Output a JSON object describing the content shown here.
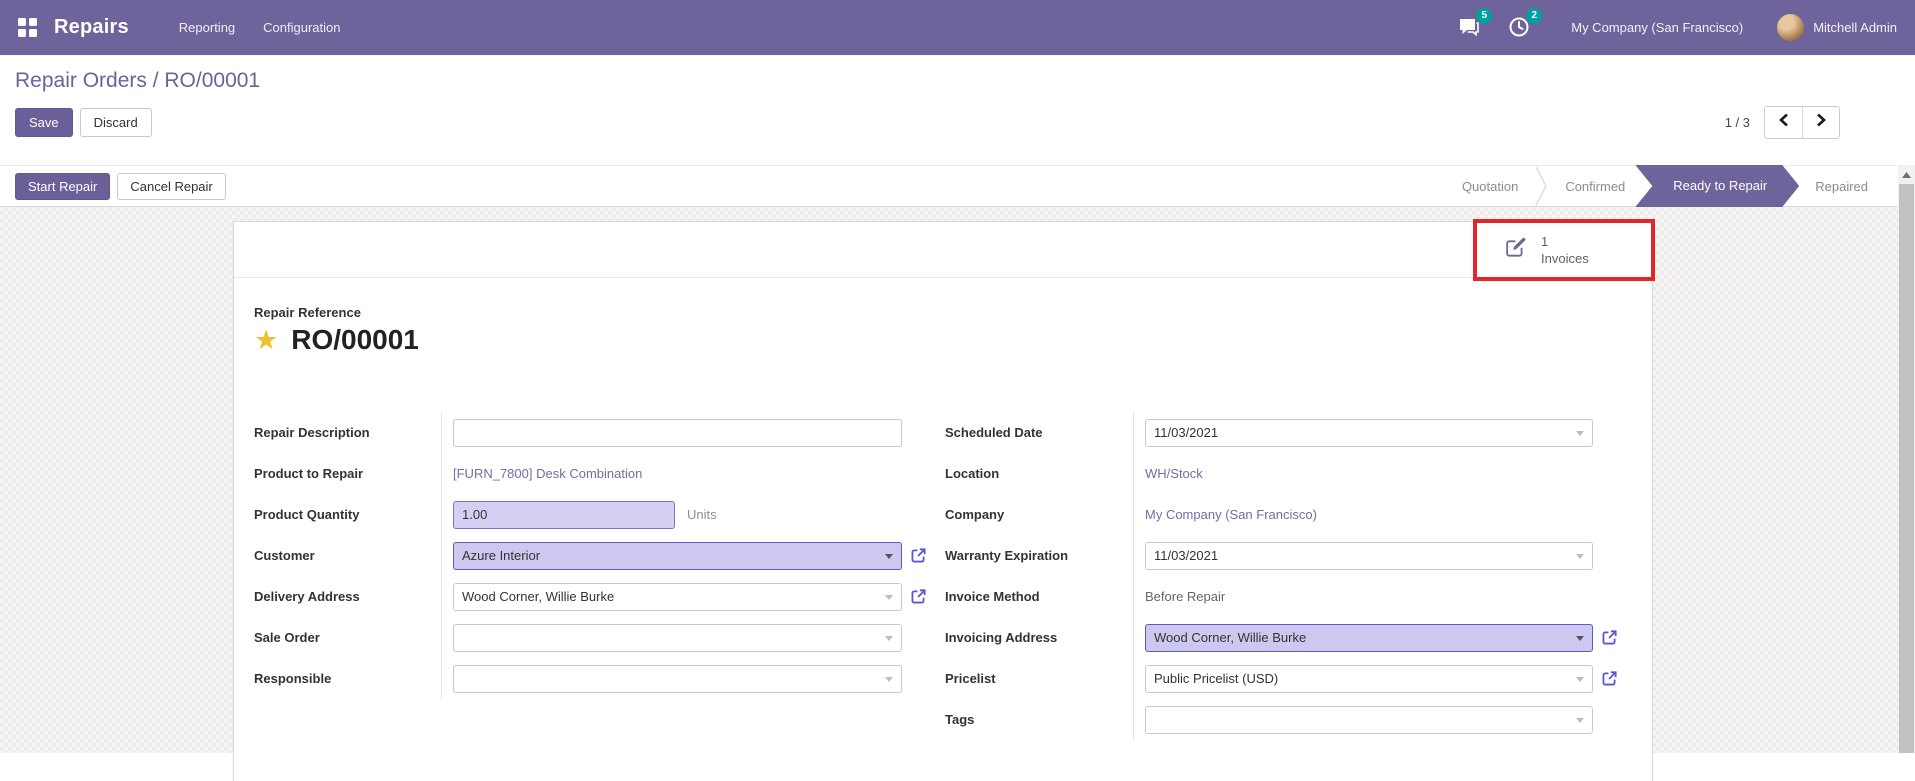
{
  "navbar": {
    "app_name": "Repairs",
    "menus": [
      {
        "label": "Reporting"
      },
      {
        "label": "Configuration"
      }
    ],
    "messages_count": "5",
    "activities_count": "2",
    "company": "My Company (San Francisco)",
    "user": "Mitchell Admin"
  },
  "breadcrumb": {
    "text": "Repair Orders / RO/00001"
  },
  "control_panel": {
    "save_label": "Save",
    "discard_label": "Discard",
    "pager_value": "1 / 3"
  },
  "statusbar": {
    "start_repair_label": "Start Repair",
    "cancel_repair_label": "Cancel Repair",
    "stages": [
      {
        "label": "Quotation",
        "active": false
      },
      {
        "label": "Confirmed",
        "active": false
      },
      {
        "label": "Ready to Repair",
        "active": true
      },
      {
        "label": "Repaired",
        "active": false
      }
    ]
  },
  "button_box": {
    "invoice_count": "1",
    "invoice_label": "Invoices"
  },
  "sheet": {
    "reference": {
      "label": "Repair Reference",
      "value": "RO/00001"
    },
    "left": [
      {
        "label": "Repair Description",
        "value": "",
        "type": "input"
      },
      {
        "label": "Product to Repair",
        "value": "[FURN_7800] Desk Combination",
        "type": "link"
      },
      {
        "label": "Product Quantity",
        "value": "1.00",
        "suffix": "Units",
        "type": "input",
        "highlighted": true
      },
      {
        "label": "Customer",
        "value": "Azure Interior",
        "type": "select",
        "highlighted": true,
        "external": true
      },
      {
        "label": "Delivery Address",
        "value": "Wood Corner, Willie Burke",
        "type": "select",
        "external": true
      },
      {
        "label": "Sale Order",
        "value": "",
        "type": "select"
      },
      {
        "label": "Responsible",
        "value": "",
        "type": "select"
      }
    ],
    "right": [
      {
        "label": "Scheduled Date",
        "value": "11/03/2021",
        "type": "date"
      },
      {
        "label": "Location",
        "value": "WH/Stock",
        "type": "link"
      },
      {
        "label": "Company",
        "value": "My Company (San Francisco)",
        "type": "link"
      },
      {
        "label": "Warranty Expiration",
        "value": "11/03/2021",
        "type": "date"
      },
      {
        "label": "Invoice Method",
        "value": "Before Repair",
        "type": "text"
      },
      {
        "label": "Invoicing Address",
        "value": "Wood Corner, Willie Burke",
        "type": "select",
        "highlighted": true,
        "external": true
      },
      {
        "label": "Pricelist",
        "value": "Public Pricelist (USD)",
        "type": "select",
        "external": true
      },
      {
        "label": "Tags",
        "value": "",
        "type": "select"
      }
    ]
  },
  "icons": {
    "apps": "grid-2x2",
    "messages": "chat-bubble",
    "activities": "clock",
    "invoices": "pencil-square",
    "external": "external-link",
    "favorite": "star",
    "prev": "chevron-left",
    "next": "chevron-right",
    "scroll_up": "triangle-up"
  },
  "colors": {
    "navbar_bg": "#6E649B",
    "primary_button": "#6B5F99",
    "badge": "#00A09D",
    "stage_active_bg": "#6E639B",
    "highlight_field_bg": "#D4D0F2",
    "highlight_field_border": "#5F59C7",
    "link_text": "#736DA6",
    "annotation_border": "#E3242B",
    "star": "#EFBF2D"
  }
}
